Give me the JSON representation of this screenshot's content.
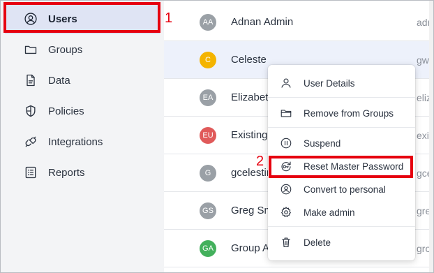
{
  "sidebar": {
    "items": [
      {
        "label": "Users",
        "icon": "user-circle-icon",
        "active": true
      },
      {
        "label": "Groups",
        "icon": "folder-icon"
      },
      {
        "label": "Data",
        "icon": "document-icon"
      },
      {
        "label": "Policies",
        "icon": "shield-icon"
      },
      {
        "label": "Integrations",
        "icon": "plug-icon"
      },
      {
        "label": "Reports",
        "icon": "checklist-icon"
      }
    ]
  },
  "annotations": {
    "step1": "1",
    "step2": "2",
    "color": "#e6000f"
  },
  "users": [
    {
      "initials": "AA",
      "name": "Adnan Admin",
      "email": "adr",
      "avatar_color": "#9aa0a6"
    },
    {
      "initials": "C",
      "name": "Celeste",
      "email": "gwe",
      "avatar_color": "#f4b400",
      "selected": true
    },
    {
      "initials": "EA",
      "name": "Elizabet",
      "email": "eliz",
      "avatar_color": "#9aa0a6"
    },
    {
      "initials": "EU",
      "name": "Existing",
      "email": "exis",
      "avatar_color": "#e05a5a"
    },
    {
      "initials": "G",
      "name": "gcelestin",
      "email": "gce",
      "avatar_color": "#9aa0a6"
    },
    {
      "initials": "GS",
      "name": "Greg Sm",
      "email": "gre",
      "avatar_color": "#9aa0a6"
    },
    {
      "initials": "GA",
      "name": "Group A",
      "email": "gro",
      "avatar_color": "#43b05c"
    }
  ],
  "context_menu": {
    "items": [
      {
        "label": "User Details",
        "icon": "user-icon"
      },
      {
        "label": "Remove from Groups",
        "icon": "folder-remove-icon"
      },
      {
        "label": "Suspend",
        "icon": "pause-icon"
      },
      {
        "label": "Reset Master Password",
        "icon": "key-reset-icon",
        "highlighted": true
      },
      {
        "label": "Convert to personal",
        "icon": "user-convert-icon"
      },
      {
        "label": "Make admin",
        "icon": "gear-icon"
      },
      {
        "label": "Delete",
        "icon": "trash-icon"
      }
    ]
  }
}
